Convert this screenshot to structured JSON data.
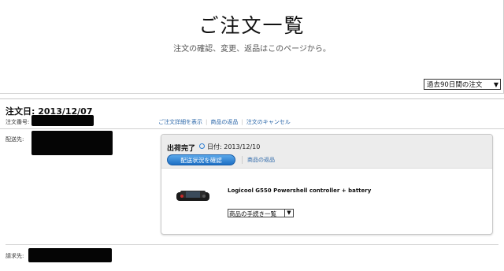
{
  "header": {
    "title": "ご注文一覧",
    "subtitle": "注文の確認、変更、返品はこのページから。",
    "period_select": "過去90日間の注文"
  },
  "order": {
    "date_label": "注文日: 2013/12/07",
    "order_number_label": "注文番号:",
    "links": [
      "ご注文詳細を表示",
      "商品の返品",
      "注文のキャンセル"
    ],
    "ship_to_label": "配送先:",
    "bill_to_label": "請求先:",
    "shipment": {
      "status": "出荷完了",
      "date": "日付: 2013/12/10",
      "track_button": "配送状況を確認",
      "return_link": "商品の返品",
      "product_name": "Logicool G550 Powershell controller + battery",
      "product_action": "商品の手続き一覧"
    }
  },
  "colors": {
    "link": "#2a66a8",
    "button": "#2d7fd3",
    "redaction": "#050505"
  }
}
